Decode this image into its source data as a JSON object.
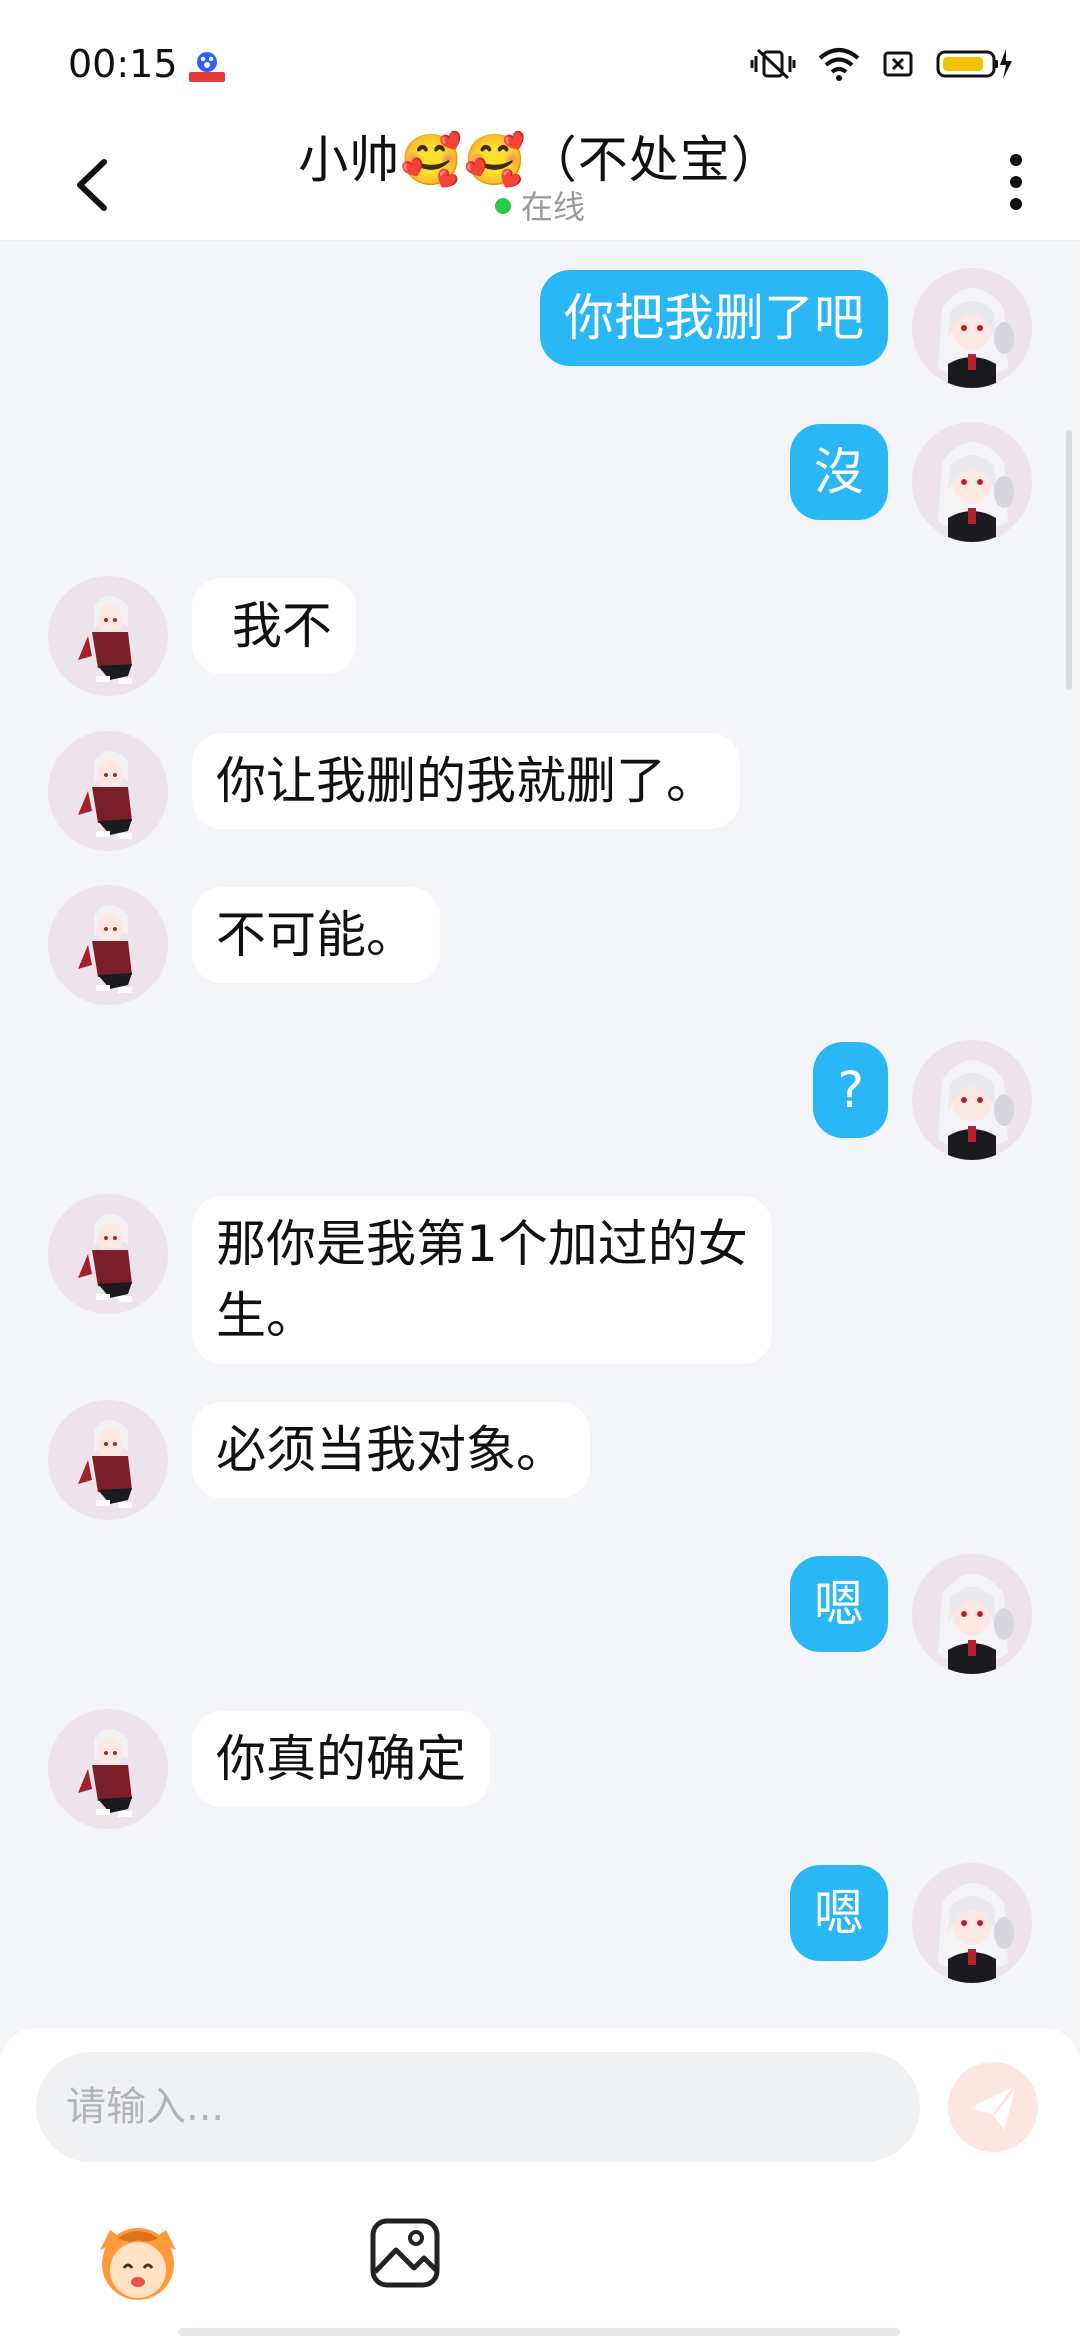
{
  "status_bar": {
    "time": "00:15",
    "app_icon": "baidu-map-icon",
    "icons": [
      "vibrate-mute-icon",
      "wifi-icon",
      "sim-off-icon",
      "battery-charging-icon"
    ],
    "battery_color": "#f5c400"
  },
  "header": {
    "title": "小帅🥰🥰（不处宝）",
    "status": "在线",
    "status_color": "#2cc84a",
    "back_icon": "chevron-left-icon",
    "more_icon": "more-vertical-icon"
  },
  "messages": [
    {
      "side": "right",
      "text": "你把我删了吧"
    },
    {
      "side": "right",
      "text": "沒"
    },
    {
      "side": "left",
      "text": " 我不"
    },
    {
      "side": "left",
      "text": "你让我删的我就删了。"
    },
    {
      "side": "left",
      "text": "不可能。"
    },
    {
      "side": "right",
      "text": "?"
    },
    {
      "side": "left",
      "text": "那你是我第1个加过的女生。"
    },
    {
      "side": "left",
      "text": "必须当我对象。"
    },
    {
      "side": "right",
      "text": "嗯"
    },
    {
      "side": "left",
      "text": "你真的确定"
    },
    {
      "side": "right",
      "text": "嗯"
    }
  ],
  "composer": {
    "placeholder": "请输入...",
    "send_icon": "send-icon",
    "emoji_icon": "emoji-sticker-icon",
    "image_icon": "image-icon"
  },
  "colors": {
    "outgoing_bubble": "#29b7f5",
    "incoming_bubble": "#ffffff",
    "background": "#f3f5f9"
  }
}
